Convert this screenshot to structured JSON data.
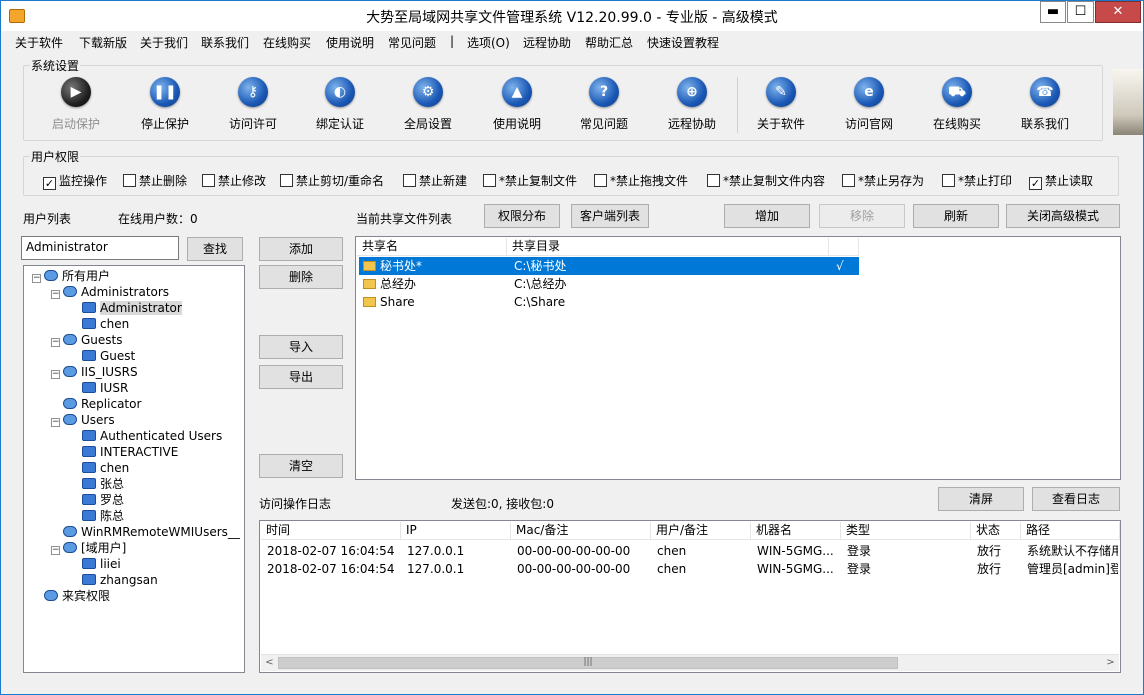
{
  "window": {
    "title": "大势至局域网共享文件管理系统 V12.20.99.0 - 专业版 - 高级模式",
    "min_label": "▬",
    "max_label": "☐",
    "close_label": "✕"
  },
  "menu": [
    "关于软件",
    "下载新版",
    "关于我们",
    "联系我们",
    "在线购买",
    "使用说明",
    "常见问题",
    "|",
    "选项(O)",
    "远程协助",
    "帮助汇总",
    "快速设置教程"
  ],
  "system_settings": {
    "label": "系统设置",
    "tools": [
      {
        "label": "启动保护",
        "icon": "play-icon",
        "glyph": "▶",
        "disabled": true
      },
      {
        "label": "停止保护",
        "icon": "pause-icon",
        "glyph": "❚❚",
        "disabled": false
      },
      {
        "label": "访问许可",
        "icon": "key-icon",
        "glyph": "⚷",
        "disabled": false
      },
      {
        "label": "绑定认证",
        "icon": "shield-icon",
        "glyph": "◐",
        "disabled": false
      },
      {
        "label": "全局设置",
        "icon": "gear-icon",
        "glyph": "⚙",
        "disabled": false
      },
      {
        "label": "使用说明",
        "icon": "graduation-cap-icon",
        "glyph": "▲",
        "disabled": false
      },
      {
        "label": "常见问题",
        "icon": "question-icon",
        "glyph": "?",
        "disabled": false
      },
      {
        "label": "远程协助",
        "icon": "globe-icon",
        "glyph": "⊕",
        "disabled": false
      },
      {
        "label": "关于软件",
        "icon": "document-icon",
        "glyph": "✎",
        "disabled": false
      },
      {
        "label": "访问官网",
        "icon": "ie-icon",
        "glyph": "e",
        "disabled": false
      },
      {
        "label": "在线购买",
        "icon": "cart-icon",
        "glyph": "⛟",
        "disabled": false
      },
      {
        "label": "联系我们",
        "icon": "phone-icon",
        "glyph": "☎",
        "disabled": false
      }
    ]
  },
  "user_permissions": {
    "label": "用户权限",
    "items": [
      {
        "label": "监控操作",
        "checked": true
      },
      {
        "label": "禁止删除",
        "checked": false
      },
      {
        "label": "禁止修改",
        "checked": false
      },
      {
        "label": "禁止剪切/重命名",
        "checked": false
      },
      {
        "label": "禁止新建",
        "checked": false
      },
      {
        "label": "*禁止复制文件",
        "checked": false
      },
      {
        "label": "*禁止拖拽文件",
        "checked": false
      },
      {
        "label": "*禁止复制文件内容",
        "checked": false
      },
      {
        "label": "*禁止另存为",
        "checked": false
      },
      {
        "label": "*禁止打印",
        "checked": false
      },
      {
        "label": "禁止读取",
        "checked": true
      }
    ],
    "check_mark": "✓"
  },
  "users": {
    "list_label": "用户列表",
    "online_label": "在线用户数：0",
    "search_value": "Administrator",
    "find_button": "查找",
    "tree": [
      {
        "label": "所有用户",
        "level": 0,
        "type": "group",
        "exp": "−"
      },
      {
        "label": "Administrators",
        "level": 1,
        "type": "group",
        "exp": "−"
      },
      {
        "label": "Administrator",
        "level": 2,
        "type": "user",
        "exp": "",
        "selected": true
      },
      {
        "label": "chen",
        "level": 2,
        "type": "user",
        "exp": ""
      },
      {
        "label": "Guests",
        "level": 1,
        "type": "group",
        "exp": "−"
      },
      {
        "label": "Guest",
        "level": 2,
        "type": "user",
        "exp": ""
      },
      {
        "label": "IIS_IUSRS",
        "level": 1,
        "type": "group",
        "exp": "−"
      },
      {
        "label": "IUSR",
        "level": 2,
        "type": "user",
        "exp": ""
      },
      {
        "label": "Replicator",
        "level": 1,
        "type": "group",
        "exp": ""
      },
      {
        "label": "Users",
        "level": 1,
        "type": "group",
        "exp": "−"
      },
      {
        "label": "Authenticated Users",
        "level": 2,
        "type": "user",
        "exp": ""
      },
      {
        "label": "INTERACTIVE",
        "level": 2,
        "type": "user",
        "exp": ""
      },
      {
        "label": "chen",
        "level": 2,
        "type": "user",
        "exp": ""
      },
      {
        "label": "张总",
        "level": 2,
        "type": "user",
        "exp": ""
      },
      {
        "label": "罗总",
        "level": 2,
        "type": "user",
        "exp": ""
      },
      {
        "label": "陈总",
        "level": 2,
        "type": "user",
        "exp": ""
      },
      {
        "label": "WinRMRemoteWMIUsers__",
        "level": 1,
        "type": "group",
        "exp": ""
      },
      {
        "label": "[域用户]",
        "level": 1,
        "type": "group",
        "exp": "−"
      },
      {
        "label": "liiei",
        "level": 2,
        "type": "user",
        "exp": ""
      },
      {
        "label": "zhangsan",
        "level": 2,
        "type": "user",
        "exp": ""
      },
      {
        "label": "来宾权限",
        "level": 0,
        "type": "group",
        "exp": ""
      }
    ]
  },
  "mid_buttons": {
    "add": "添加",
    "delete": "删除",
    "import": "导入",
    "export": "导出",
    "clear": "清空"
  },
  "shares": {
    "label": "当前共享文件列表",
    "perm_button": "权限分布",
    "client_button": "客户端列表",
    "add_button": "增加",
    "remove_button": "移除",
    "refresh_button": "刷新",
    "close_adv_button": "关闭高级模式",
    "columns": [
      "共享名",
      "共享目录",
      ""
    ],
    "rows": [
      {
        "name": "秘书处*",
        "path": "C:\\秘书处",
        "mark": "√",
        "selected": true
      },
      {
        "name": "总经办",
        "path": "C:\\总经办",
        "mark": "",
        "selected": false
      },
      {
        "name": "Share",
        "path": "C:\\Share",
        "mark": "",
        "selected": false
      }
    ]
  },
  "log": {
    "label": "访问操作日志",
    "packets": "发送包:0, 接收包:0",
    "clear_button": "清屏",
    "view_button": "查看日志",
    "columns": [
      "时间",
      "IP",
      "Mac/备注",
      "用户/备注",
      "机器名",
      "类型",
      "状态",
      "路径"
    ],
    "rows": [
      [
        "2018-02-07 16:04:54",
        "127.0.0.1",
        "00-00-00-00-00-00",
        "chen",
        "WIN-5GMG...",
        "登录",
        "放行",
        "系统默认不存储用"
      ],
      [
        "2018-02-07 16:04:54",
        "127.0.0.1",
        "00-00-00-00-00-00",
        "chen",
        "WIN-5GMG...",
        "登录",
        "放行",
        "管理员[admin]登"
      ]
    ],
    "scroll_left": "<",
    "scroll_right": ">",
    "scroll_grip": "|||"
  }
}
